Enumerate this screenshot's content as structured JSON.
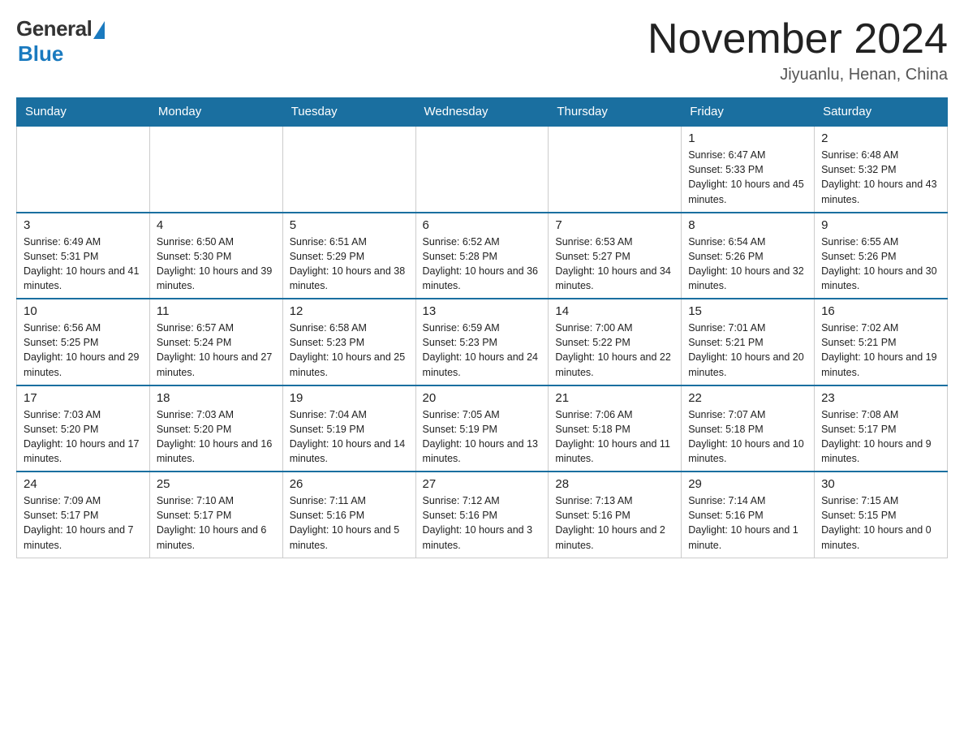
{
  "logo": {
    "general": "General",
    "blue": "Blue"
  },
  "title": "November 2024",
  "location": "Jiyuanlu, Henan, China",
  "days_of_week": [
    "Sunday",
    "Monday",
    "Tuesday",
    "Wednesday",
    "Thursday",
    "Friday",
    "Saturday"
  ],
  "weeks": [
    [
      {
        "num": "",
        "info": ""
      },
      {
        "num": "",
        "info": ""
      },
      {
        "num": "",
        "info": ""
      },
      {
        "num": "",
        "info": ""
      },
      {
        "num": "",
        "info": ""
      },
      {
        "num": "1",
        "info": "Sunrise: 6:47 AM\nSunset: 5:33 PM\nDaylight: 10 hours and 45 minutes."
      },
      {
        "num": "2",
        "info": "Sunrise: 6:48 AM\nSunset: 5:32 PM\nDaylight: 10 hours and 43 minutes."
      }
    ],
    [
      {
        "num": "3",
        "info": "Sunrise: 6:49 AM\nSunset: 5:31 PM\nDaylight: 10 hours and 41 minutes."
      },
      {
        "num": "4",
        "info": "Sunrise: 6:50 AM\nSunset: 5:30 PM\nDaylight: 10 hours and 39 minutes."
      },
      {
        "num": "5",
        "info": "Sunrise: 6:51 AM\nSunset: 5:29 PM\nDaylight: 10 hours and 38 minutes."
      },
      {
        "num": "6",
        "info": "Sunrise: 6:52 AM\nSunset: 5:28 PM\nDaylight: 10 hours and 36 minutes."
      },
      {
        "num": "7",
        "info": "Sunrise: 6:53 AM\nSunset: 5:27 PM\nDaylight: 10 hours and 34 minutes."
      },
      {
        "num": "8",
        "info": "Sunrise: 6:54 AM\nSunset: 5:26 PM\nDaylight: 10 hours and 32 minutes."
      },
      {
        "num": "9",
        "info": "Sunrise: 6:55 AM\nSunset: 5:26 PM\nDaylight: 10 hours and 30 minutes."
      }
    ],
    [
      {
        "num": "10",
        "info": "Sunrise: 6:56 AM\nSunset: 5:25 PM\nDaylight: 10 hours and 29 minutes."
      },
      {
        "num": "11",
        "info": "Sunrise: 6:57 AM\nSunset: 5:24 PM\nDaylight: 10 hours and 27 minutes."
      },
      {
        "num": "12",
        "info": "Sunrise: 6:58 AM\nSunset: 5:23 PM\nDaylight: 10 hours and 25 minutes."
      },
      {
        "num": "13",
        "info": "Sunrise: 6:59 AM\nSunset: 5:23 PM\nDaylight: 10 hours and 24 minutes."
      },
      {
        "num": "14",
        "info": "Sunrise: 7:00 AM\nSunset: 5:22 PM\nDaylight: 10 hours and 22 minutes."
      },
      {
        "num": "15",
        "info": "Sunrise: 7:01 AM\nSunset: 5:21 PM\nDaylight: 10 hours and 20 minutes."
      },
      {
        "num": "16",
        "info": "Sunrise: 7:02 AM\nSunset: 5:21 PM\nDaylight: 10 hours and 19 minutes."
      }
    ],
    [
      {
        "num": "17",
        "info": "Sunrise: 7:03 AM\nSunset: 5:20 PM\nDaylight: 10 hours and 17 minutes."
      },
      {
        "num": "18",
        "info": "Sunrise: 7:03 AM\nSunset: 5:20 PM\nDaylight: 10 hours and 16 minutes."
      },
      {
        "num": "19",
        "info": "Sunrise: 7:04 AM\nSunset: 5:19 PM\nDaylight: 10 hours and 14 minutes."
      },
      {
        "num": "20",
        "info": "Sunrise: 7:05 AM\nSunset: 5:19 PM\nDaylight: 10 hours and 13 minutes."
      },
      {
        "num": "21",
        "info": "Sunrise: 7:06 AM\nSunset: 5:18 PM\nDaylight: 10 hours and 11 minutes."
      },
      {
        "num": "22",
        "info": "Sunrise: 7:07 AM\nSunset: 5:18 PM\nDaylight: 10 hours and 10 minutes."
      },
      {
        "num": "23",
        "info": "Sunrise: 7:08 AM\nSunset: 5:17 PM\nDaylight: 10 hours and 9 minutes."
      }
    ],
    [
      {
        "num": "24",
        "info": "Sunrise: 7:09 AM\nSunset: 5:17 PM\nDaylight: 10 hours and 7 minutes."
      },
      {
        "num": "25",
        "info": "Sunrise: 7:10 AM\nSunset: 5:17 PM\nDaylight: 10 hours and 6 minutes."
      },
      {
        "num": "26",
        "info": "Sunrise: 7:11 AM\nSunset: 5:16 PM\nDaylight: 10 hours and 5 minutes."
      },
      {
        "num": "27",
        "info": "Sunrise: 7:12 AM\nSunset: 5:16 PM\nDaylight: 10 hours and 3 minutes."
      },
      {
        "num": "28",
        "info": "Sunrise: 7:13 AM\nSunset: 5:16 PM\nDaylight: 10 hours and 2 minutes."
      },
      {
        "num": "29",
        "info": "Sunrise: 7:14 AM\nSunset: 5:16 PM\nDaylight: 10 hours and 1 minute."
      },
      {
        "num": "30",
        "info": "Sunrise: 7:15 AM\nSunset: 5:15 PM\nDaylight: 10 hours and 0 minutes."
      }
    ]
  ]
}
